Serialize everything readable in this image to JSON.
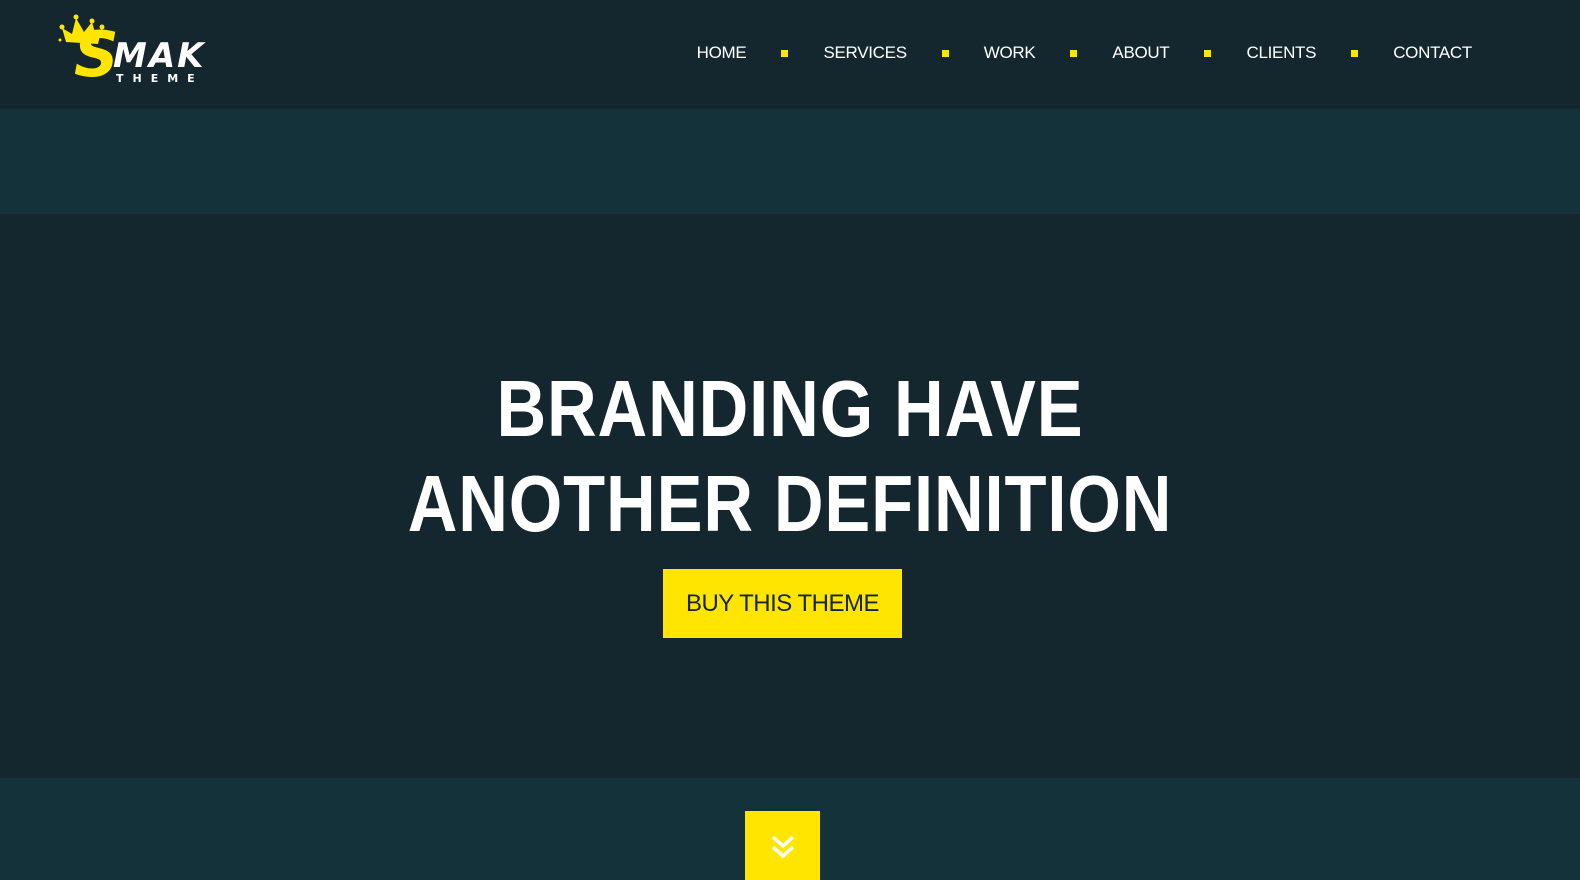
{
  "brand": {
    "logo_initial": "S",
    "logo_word": "MAK",
    "logo_sub": "THEME"
  },
  "nav": {
    "items": [
      {
        "label": "HOME"
      },
      {
        "label": "SERVICES"
      },
      {
        "label": "WORK"
      },
      {
        "label": "ABOUT"
      },
      {
        "label": "CLIENTS"
      },
      {
        "label": "CONTACT"
      }
    ]
  },
  "hero": {
    "title_line1": "BRANDING HAVE",
    "title_line2": "ANOTHER DEFINITION",
    "cta_label": "BUY THIS THEME"
  },
  "icons": {
    "logo": "crown-icon",
    "scroll": "double-chevron-down-icon"
  },
  "colors": {
    "accent": "#ffe500",
    "background": "#15272e",
    "band": "#13323a",
    "text": "#ffffff"
  }
}
